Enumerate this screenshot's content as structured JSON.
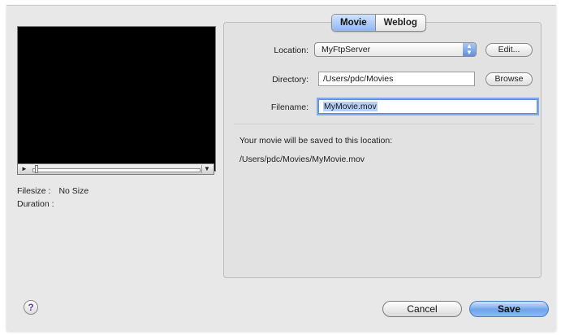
{
  "tabs": [
    {
      "label": "Movie",
      "active": true
    },
    {
      "label": "Weblog",
      "active": false
    }
  ],
  "preview": {
    "controls": {
      "play_glyph": "►",
      "menu_glyph": "▼"
    },
    "filesize_label": "Filesize :",
    "filesize_value": "No Size",
    "duration_label": "Duration :"
  },
  "form": {
    "location": {
      "label": "Location:",
      "value": "MyFtpServer",
      "edit_label": "Edit..."
    },
    "directory": {
      "label": "Directory:",
      "value": "/Users/pdc/Movies",
      "browse_label": "Browse"
    },
    "filename": {
      "label": "Filename:",
      "value": "MyMovie.mov"
    }
  },
  "save_message": "Your movie will be saved to this location:",
  "save_path": "/Users/pdc/Movies/MyMovie.mov",
  "footer": {
    "help_glyph": "?",
    "cancel_label": "Cancel",
    "save_label": "Save"
  },
  "colors": {
    "accent": "#6fa3ea",
    "selection": "#b5d0f7"
  }
}
